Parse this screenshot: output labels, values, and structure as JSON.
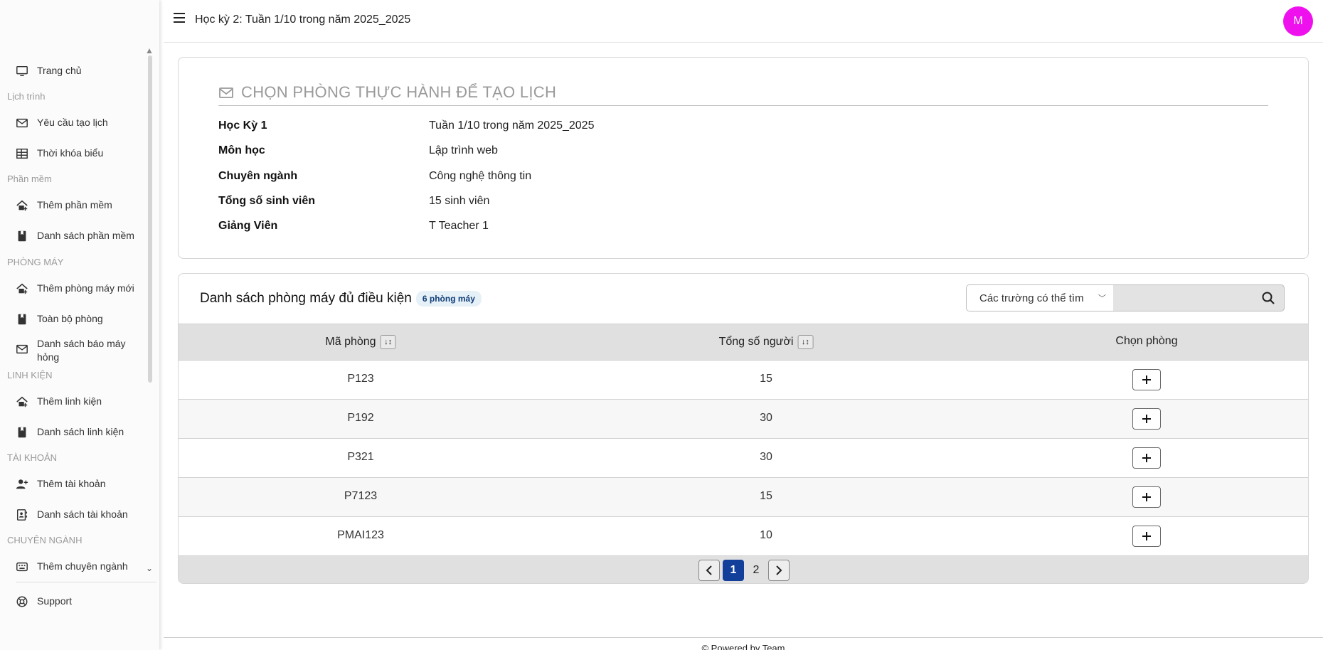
{
  "header": {
    "title": "Học kỳ 2: Tuần 1/10 trong năm 2025_2025",
    "avatar_initial": "M",
    "avatar_color": "#ee11ee"
  },
  "sidebar": {
    "home": {
      "label": "Trang chủ",
      "icon": "monitor-icon"
    },
    "sections": {
      "schedule": "Lịch trình",
      "software": "Phần mềm",
      "rooms": "PHÒNG MÁY",
      "components": "LINH KIỆN",
      "accounts": "TÀI KHOẢN",
      "majors": "CHUYÊN NGÀNH"
    },
    "items": {
      "schedule_request": {
        "label": "Yêu cầu tạo lịch",
        "icon": "envelope-icon"
      },
      "timetable": {
        "label": "Thời khóa biểu",
        "icon": "table-icon"
      },
      "add_software": {
        "label": "Thêm phần mềm",
        "icon": "house-plus-icon"
      },
      "software_list": {
        "label": "Danh sách phần mềm",
        "icon": "bookmark-icon"
      },
      "add_room": {
        "label": "Thêm phòng máy mới",
        "icon": "house-plus-icon"
      },
      "all_rooms": {
        "label": "Toàn bộ phòng",
        "icon": "bookmark-icon"
      },
      "broken_reports": {
        "label": "Danh sách báo máy hỏng",
        "icon": "envelope-icon"
      },
      "add_component": {
        "label": "Thêm linh kiện",
        "icon": "house-plus-icon"
      },
      "component_list": {
        "label": "Danh sách linh kiện",
        "icon": "bookmark-icon"
      },
      "add_account": {
        "label": "Thêm tài khoản",
        "icon": "user-plus-icon"
      },
      "account_list": {
        "label": "Danh sách tài khoản",
        "icon": "contact-card-icon"
      },
      "add_major": {
        "label": "Thêm chuyên ngành",
        "icon": "keyboard-icon"
      }
    },
    "support": {
      "label": "Support",
      "icon": "lifebuoy-icon"
    }
  },
  "info_card": {
    "title": "CHỌN PHÒNG THỰC HÀNH ĐỂ TẠO LỊCH",
    "rows": [
      {
        "key": "Học Kỳ 1",
        "value": "Tuần 1/10 trong năm 2025_2025"
      },
      {
        "key": "Môn học",
        "value": "Lập trình web"
      },
      {
        "key": "Chuyên ngành",
        "value": "Công nghệ thông tin"
      },
      {
        "key": "Tổng số sinh viên",
        "value": "15 sinh viên"
      },
      {
        "key": "Giảng Viên",
        "value": "T Teacher 1"
      }
    ]
  },
  "rooms_table": {
    "title": "Danh sách phòng máy đủ điều kiện",
    "count_badge": "6 phòng máy",
    "search": {
      "select_label": "Các trường có thể tìm",
      "value": ""
    },
    "columns": [
      "Mã phòng",
      "Tổng số người",
      "Chọn phòng"
    ],
    "rows": [
      {
        "room": "P123",
        "capacity": "15"
      },
      {
        "room": "P192",
        "capacity": "30"
      },
      {
        "room": "P321",
        "capacity": "30"
      },
      {
        "room": "P7123",
        "capacity": "15"
      },
      {
        "room": "PMAI123",
        "capacity": "10"
      }
    ],
    "pagination": {
      "prev": "‹",
      "pages": [
        "1",
        "2"
      ],
      "current": "1",
      "next": "›"
    }
  },
  "footer": {
    "text": "© Powered by Team"
  }
}
